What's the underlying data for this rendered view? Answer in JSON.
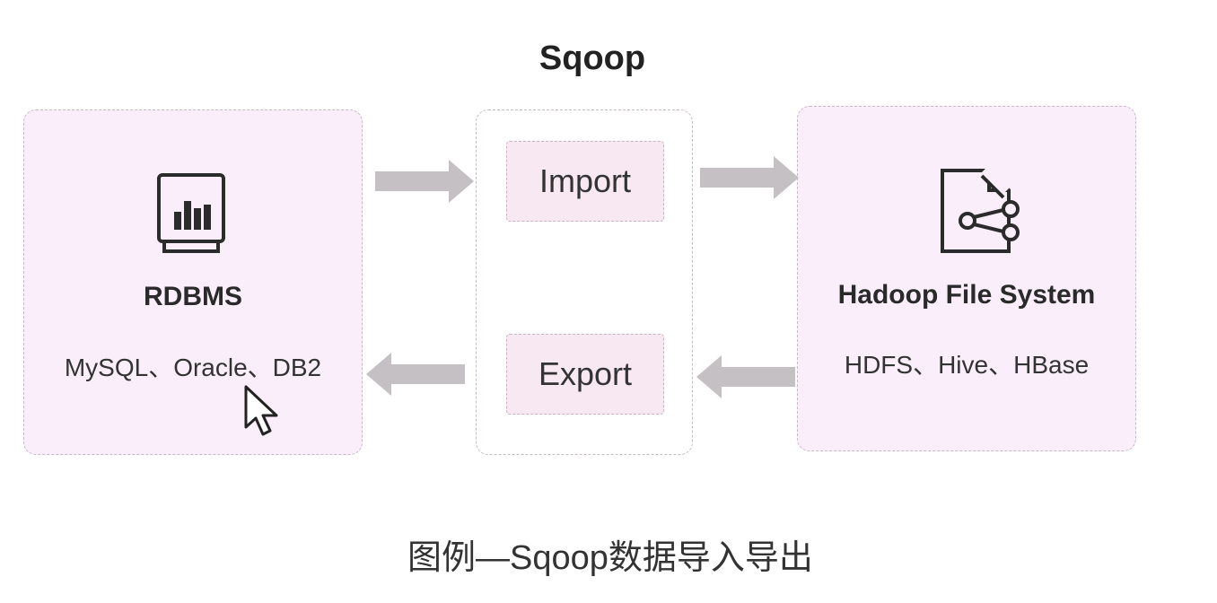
{
  "title": "Sqoop",
  "source": {
    "label": "RDBMS",
    "examples": "MySQL、Oracle、DB2",
    "icon": "database-chart-icon"
  },
  "operations": {
    "import_label": "Import",
    "export_label": "Export"
  },
  "target": {
    "label": "Hadoop File System",
    "examples": "HDFS、Hive、HBase",
    "icon": "file-share-icon"
  },
  "caption": "图例—Sqoop数据导入导出",
  "colors": {
    "panel_fill": "#fbeefb",
    "op_fill": "#f7e8f2",
    "border": "#c8b8c4",
    "arrow": "#c4c0c4",
    "icon": "#2b2b2b"
  }
}
